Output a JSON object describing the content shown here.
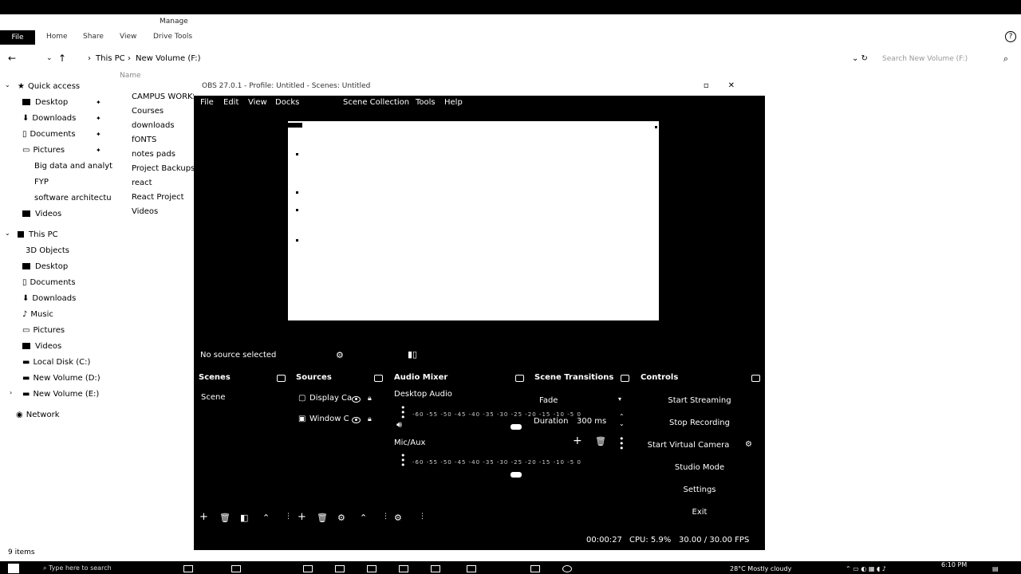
{
  "explorer": {
    "title_tab": "Manage",
    "ribbon": [
      "File",
      "Home",
      "Share",
      "View",
      "Drive Tools"
    ],
    "breadcrumb": [
      "This PC",
      "New Volume (F:)"
    ],
    "search_placeholder": "Search New Volume (F:)",
    "column_name": "Name",
    "status": "9 items",
    "quick_access": {
      "label": "Quick access",
      "items": [
        "Desktop",
        "Downloads",
        "Documents",
        "Pictures",
        "Big data and analyt",
        "FYP",
        "software architectu",
        "Videos"
      ]
    },
    "this_pc": {
      "label": "This PC",
      "items": [
        "3D Objects",
        "Desktop",
        "Documents",
        "Downloads",
        "Music",
        "Pictures",
        "Videos",
        "Local Disk (C:)",
        "New Volume (D:)",
        "New Volume (E:)"
      ]
    },
    "network": "Network",
    "files": [
      "CAMPUS WORKS",
      "Courses",
      "downloads",
      "fONTS",
      "notes pads",
      "Project Backups",
      "react",
      "React Project",
      "Videos"
    ]
  },
  "obs": {
    "title": "OBS 27.0.1 - Profile: Untitled - Scenes: Untitled",
    "menu": [
      "File",
      "Edit",
      "View",
      "Docks",
      "Scene Collection",
      "Tools",
      "Help"
    ],
    "no_source": "No source selected",
    "docks": {
      "scenes": "Scenes",
      "sources": "Sources",
      "audio_mixer": "Audio Mixer",
      "scene_transitions": "Scene Transitions",
      "controls": "Controls"
    },
    "scene_list": [
      "Scene"
    ],
    "source_list": [
      "Display Ca",
      "Window C"
    ],
    "audio": [
      {
        "name": "Desktop Audio",
        "scale": "-60 -55 -50 -45 -40 -35 -30 -25 -20 -15 -10 -5 0"
      },
      {
        "name": "Mic/Aux",
        "scale": "-60 -55 -50 -45 -40 -35 -30 -25 -20 -15 -10 -5 0"
      }
    ],
    "transition": {
      "type": "Fade",
      "duration_label": "Duration",
      "duration_value": "300 ms"
    },
    "controls": [
      "Start Streaming",
      "Stop Recording",
      "Start Virtual Camera",
      "Studio Mode",
      "Settings",
      "Exit"
    ],
    "status": {
      "time": "00:00:27",
      "cpu": "CPU: 5.9%",
      "fps": "30.00 / 30.00 FPS"
    }
  },
  "taskbar": {
    "search": "Type here to search",
    "weather": "28°C  Mostly cloudy",
    "time": "6:10 PM"
  }
}
